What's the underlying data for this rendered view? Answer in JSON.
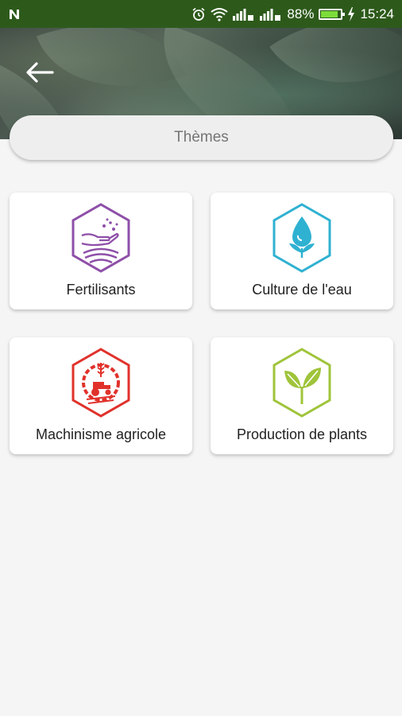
{
  "status_bar": {
    "notification_icon": "n-icon",
    "battery_percent": "88%",
    "time": "15:24"
  },
  "header": {
    "back_icon": "arrow-left-icon"
  },
  "search": {
    "label": "Thèmes"
  },
  "themes": [
    {
      "label": "Fertilisants",
      "icon": "hand-seeds-icon",
      "color": "#8e4fa8"
    },
    {
      "label": "Culture de l'eau",
      "icon": "water-drop-leaf-icon",
      "color": "#2fb1d1"
    },
    {
      "label": "Machinisme agricole",
      "icon": "tractor-gear-icon",
      "color": "#e0322b"
    },
    {
      "label": "Production de plants",
      "icon": "two-leaves-icon",
      "color": "#9fc43a"
    }
  ]
}
